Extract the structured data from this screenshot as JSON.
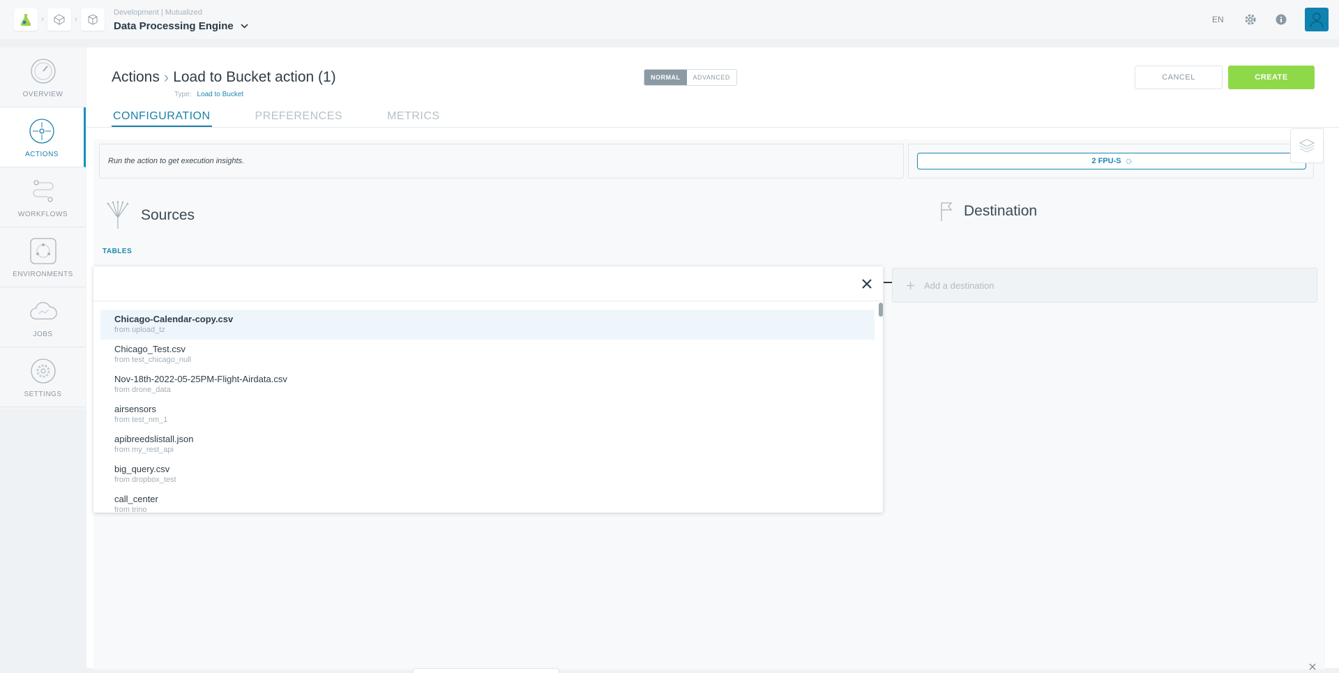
{
  "header": {
    "project_sub": "Development | Mutualized",
    "project_title": "Data Processing Engine",
    "language": "EN"
  },
  "nav": {
    "items": [
      {
        "label": "OVERVIEW",
        "icon": "gauge-icon"
      },
      {
        "label": "ACTIONS",
        "icon": "target-icon"
      },
      {
        "label": "WORKFLOWS",
        "icon": "workflow-icon"
      },
      {
        "label": "ENVIRONMENTS",
        "icon": "network-icon"
      },
      {
        "label": "JOBS",
        "icon": "cloud-icon"
      },
      {
        "label": "SETTINGS",
        "icon": "gear-icon"
      }
    ],
    "active": "ACTIONS"
  },
  "page": {
    "breadcrumb_root": "Actions",
    "title": "Load to Bucket action (1)",
    "type_label": "Type:",
    "type_value": "Load to Bucket",
    "mode_normal": "NORMAL",
    "mode_advanced": "ADVANCED",
    "cancel_label": "CANCEL",
    "create_label": "CREATE"
  },
  "tabs": [
    "CONFIGURATION",
    "PREFERENCES",
    "METRICS"
  ],
  "insights_text": "Run the action to get execution insights.",
  "fpu_label": "2 FPU-S",
  "sources": {
    "title": "Sources",
    "tables_label": "TABLES"
  },
  "destination": {
    "title": "Destination",
    "placeholder": "Add a destination"
  },
  "dropdown": {
    "items": [
      {
        "name": "Chicago-Calendar-copy.csv",
        "source": "from upload_tz"
      },
      {
        "name": "Chicago_Test.csv",
        "source": "from test_chicago_null"
      },
      {
        "name": "Nov-18th-2022-05-25PM-Flight-Airdata.csv",
        "source": "from drone_data"
      },
      {
        "name": "airsensors",
        "source": "from test_nm_1"
      },
      {
        "name": "apibreedslistall.json",
        "source": "from my_rest_api"
      },
      {
        "name": "big_query.csv",
        "source": "from dropbox_test"
      },
      {
        "name": "call_center",
        "source": "from trino"
      }
    ]
  },
  "colors": {
    "accent": "#1b86b3",
    "create": "#8ed94a",
    "avatar": "#0f82b0"
  }
}
